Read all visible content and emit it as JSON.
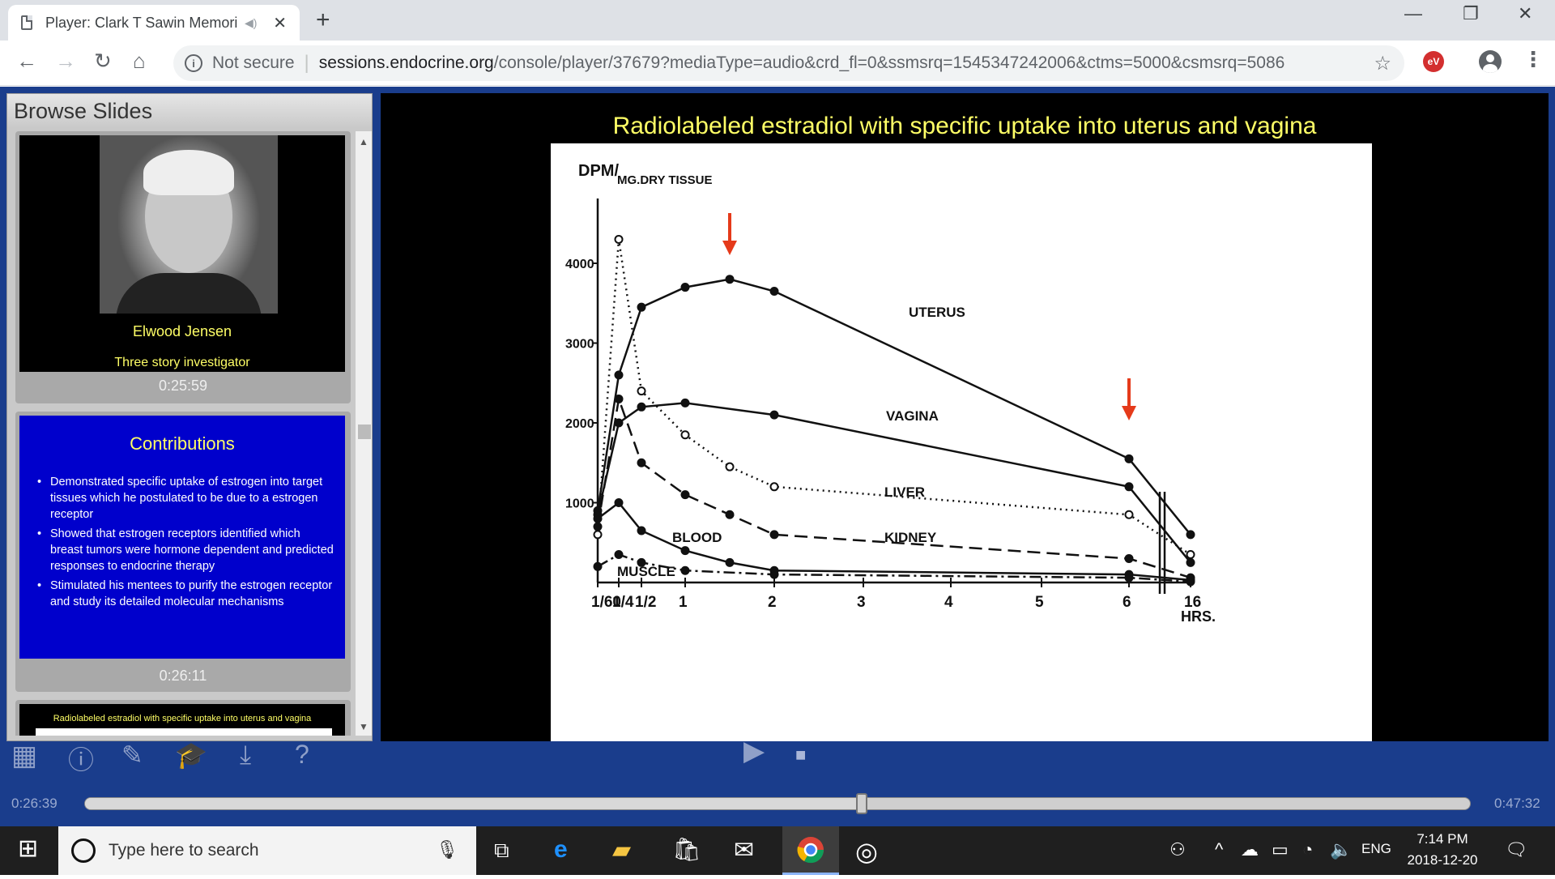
{
  "browser": {
    "tab_title": "Player: Clark T Sawin Memori",
    "url_security": "Not secure",
    "url_host": "sessions.endocrine.org",
    "url_path": "/console/player/37679?mediaType=audio&crd_fl=0&ssmsrq=1545347242006&ctms=5000&csmsrq=5086",
    "extension_label": "eV"
  },
  "browse": {
    "title": "Browse Slides",
    "slides": [
      {
        "name": "Elwood Jensen",
        "subtitle": "Three story investigator",
        "time": "0:25:59"
      },
      {
        "heading": "Contributions",
        "bullets": [
          "Demonstrated specific uptake of estrogen into target tissues  which he postulated to be due to a estrogen receptor",
          "Showed that estrogen receptors identified which breast tumors were hormone dependent  and predicted responses to endocrine therapy",
          "Stimulated his mentees to purify the estrogen receptor and study its detailed molecular mechanisms"
        ],
        "time": "0:26:11"
      },
      {
        "heading": "Radiolabeled estradiol with specific uptake into uterus and vagina"
      }
    ]
  },
  "slide": {
    "title": "Radiolabeled estradiol with specific uptake into uterus and vagina"
  },
  "chart_data": {
    "type": "line",
    "title": "",
    "ylabel_main": "DPM/",
    "ylabel_sub": "MG.DRY TISSUE",
    "xlabel": "HRS.",
    "x_ticks": [
      "1/60",
      "1/4",
      "1/2",
      "1",
      "2",
      "3",
      "4",
      "5",
      "6",
      "16"
    ],
    "y_ticks": [
      "4000",
      "3000",
      "2000",
      "1000"
    ],
    "ylim": [
      0,
      4500
    ],
    "series": [
      {
        "name": "UTERUS",
        "style": "solid",
        "x": [
          0.0167,
          0.25,
          0.5,
          1,
          1.5,
          2,
          6,
          16
        ],
        "y": [
          900,
          2600,
          3450,
          3700,
          3800,
          3650,
          1550,
          600
        ]
      },
      {
        "name": "VAGINA",
        "style": "solid",
        "x": [
          0.0167,
          0.25,
          0.5,
          1,
          2,
          6,
          16
        ],
        "y": [
          850,
          2000,
          2200,
          2250,
          2100,
          1200,
          250
        ]
      },
      {
        "name": "LIVER",
        "style": "dotted",
        "x": [
          0.0167,
          0.25,
          0.5,
          1,
          1.5,
          2,
          6,
          16
        ],
        "y": [
          600,
          4300,
          2400,
          1850,
          1450,
          1200,
          850,
          350
        ]
      },
      {
        "name": "KIDNEY",
        "style": "dashed",
        "x": [
          0.0167,
          0.25,
          0.5,
          1,
          1.5,
          2,
          6,
          16
        ],
        "y": [
          700,
          2300,
          1500,
          1100,
          850,
          600,
          300,
          60
        ]
      },
      {
        "name": "BLOOD",
        "style": "solid",
        "x": [
          0.0167,
          0.25,
          0.5,
          1,
          1.5,
          2,
          6,
          16
        ],
        "y": [
          800,
          1000,
          650,
          400,
          250,
          150,
          100,
          30
        ]
      },
      {
        "name": "MUSCLE",
        "style": "dash-dot",
        "x": [
          0.0167,
          0.25,
          0.5,
          1,
          2,
          6,
          16
        ],
        "y": [
          200,
          350,
          250,
          150,
          100,
          60,
          10
        ]
      }
    ],
    "annotations": [
      {
        "type": "arrow",
        "color": "#e53a1a",
        "x": 1.5,
        "points_to": "UTERUS peak"
      },
      {
        "type": "arrow",
        "color": "#e53a1a",
        "x": 6,
        "points_to": "UTERUS at 6 hrs"
      }
    ],
    "grid": false
  },
  "player": {
    "current_time": "0:26:39",
    "total_time": "0:47:32",
    "progress": 0.561
  },
  "taskbar": {
    "search_placeholder": "Type here to search",
    "language": "ENG",
    "time": "7:14 PM",
    "date": "2018-12-20"
  }
}
